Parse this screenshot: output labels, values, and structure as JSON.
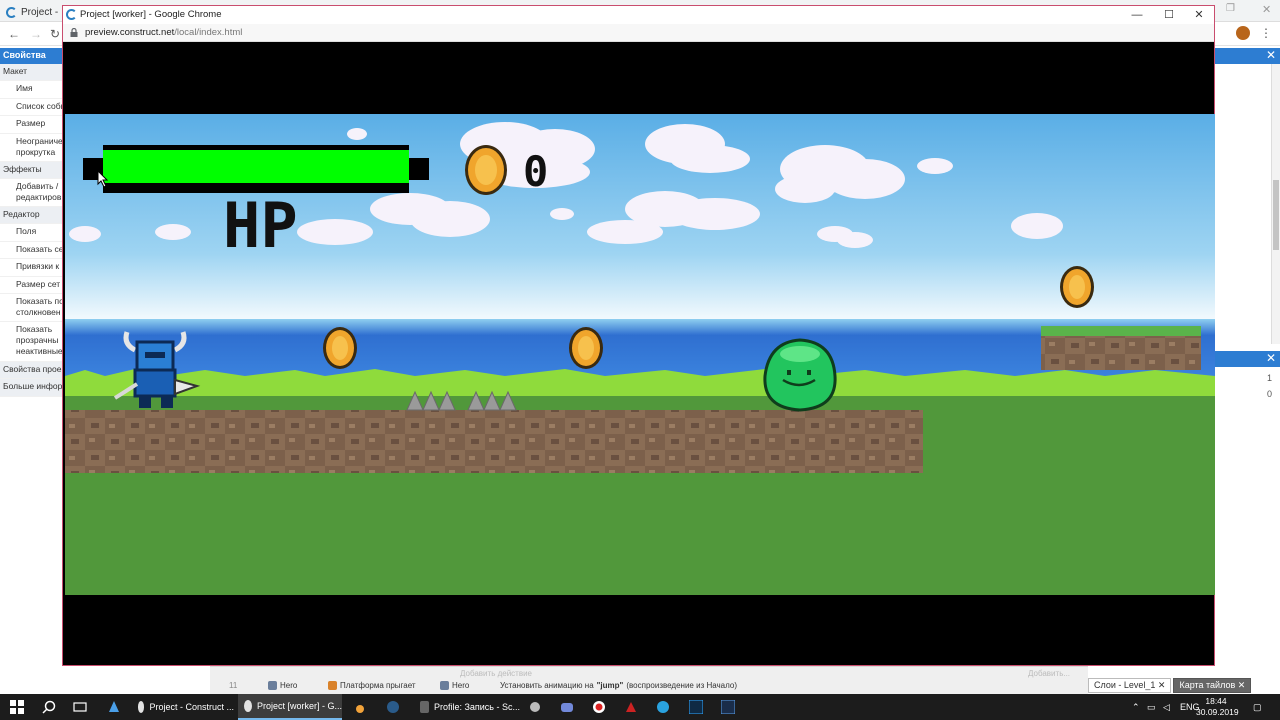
{
  "colors": {
    "accent_blue": "#2d7dd2",
    "window_border": "#c94d6e",
    "hp_fill": "#00ff00",
    "coin": "#f0a52c",
    "sky": "#6fb8e8",
    "ground_green": "#51983b",
    "dirt": "#7f6450",
    "taskbar": "#1c1c1c"
  },
  "background_browser": {
    "tab_title": "Project -",
    "restore_icon": "restore-icon",
    "close_icon": "close-icon"
  },
  "properties_panel": {
    "header": "Свойства",
    "items": [
      {
        "label": "Макет",
        "cat": true
      },
      {
        "label": "Имя"
      },
      {
        "label": "Список собы"
      },
      {
        "label": "Размер"
      },
      {
        "label": "Неограничен прокрутка",
        "tall": true
      },
      {
        "label": "Эффекты",
        "cat": true
      },
      {
        "label": "Добавить / редактиров",
        "tall": true
      },
      {
        "label": "Редактор",
        "cat": true
      },
      {
        "label": "Поля"
      },
      {
        "label": "Показать се"
      },
      {
        "label": "Привязки к"
      },
      {
        "label": "Размер сет"
      },
      {
        "label": "Показать по столкновен",
        "tall": true
      },
      {
        "label": "Показать прозрачны неактивные",
        "tall3": true
      },
      {
        "label": "Свойства прое",
        "cat": true
      },
      {
        "label": "Больше инфор",
        "cat": true
      }
    ]
  },
  "right_panel": {
    "num_1": "1",
    "num_0": "0"
  },
  "event_sheet": {
    "faded_left": "Добавить действие",
    "faded_right": "Добавить...",
    "row_number": "11",
    "items": [
      {
        "label": "Hero"
      },
      {
        "label": "Платформа прыгает"
      },
      {
        "label": "Hero"
      }
    ],
    "action_prefix": "Установить анимацию на",
    "action_bold": "\"jump\"",
    "action_suffix": "(воспроизведение из Начало)"
  },
  "layer_tabs": [
    {
      "label": "Слои - Level_1 ✕"
    },
    {
      "label": "Карта тайлов ✕"
    }
  ],
  "preview_window": {
    "title": "Project [worker] - Google Chrome",
    "url_host": "preview.construct.net",
    "url_path": "/local/index.html",
    "minimize": "—",
    "maximize": "☐",
    "close": "✕"
  },
  "game": {
    "hp_label": "HP",
    "hp_fraction": 1.0,
    "coin_count": "0"
  },
  "taskbar": {
    "start_icon": "windows-icon",
    "search_icon": "search-icon",
    "taskview_icon": "task-view-icon",
    "items": [
      {
        "label": "Project - Construct ..."
      },
      {
        "label": "Project [worker] - G..."
      },
      {
        "label": "Profile: Запись - Sc..."
      }
    ],
    "language": "ENG",
    "time": "18:44",
    "date": "30.09.2019"
  }
}
